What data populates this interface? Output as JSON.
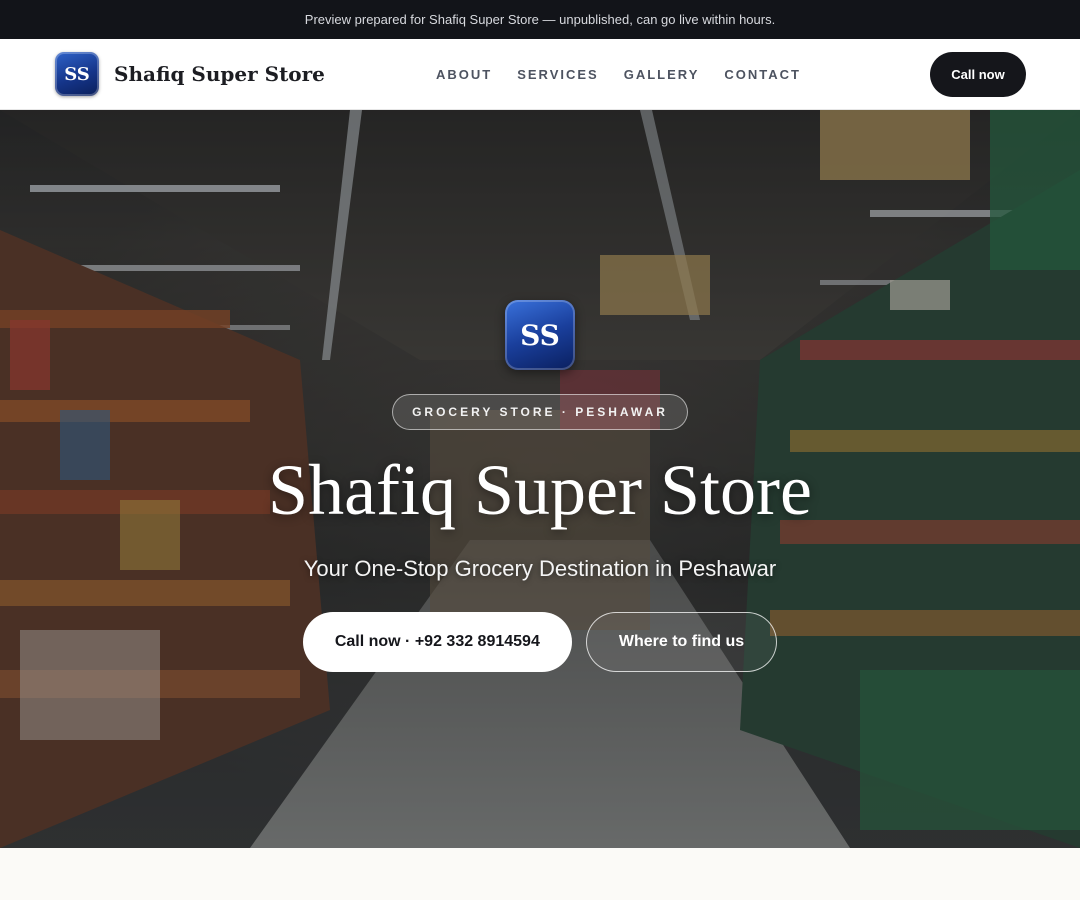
{
  "preview_bar": {
    "text": "Preview prepared for Shafiq Super Store — unpublished, can go live within hours."
  },
  "header": {
    "logo_text": "SS",
    "brand_name": "Shafiq Super Store",
    "nav": [
      {
        "label": "ABOUT"
      },
      {
        "label": "SERVICES"
      },
      {
        "label": "GALLERY"
      },
      {
        "label": "CONTACT"
      }
    ],
    "call_label": "Call now"
  },
  "hero": {
    "logo_text": "SS",
    "pill": "GROCERY STORE · PESHAWAR",
    "title": "Shafiq Super Store",
    "subtitle": "Your One-Stop Grocery Destination in Peshawar",
    "cta_primary": "Call now · +92 332 8914594",
    "cta_secondary": "Where to find us"
  },
  "colors": {
    "dark": "#121419",
    "button_dark": "#15161b",
    "logo_blue": "#1a3f9c",
    "page_bg": "#fbfaf7"
  }
}
